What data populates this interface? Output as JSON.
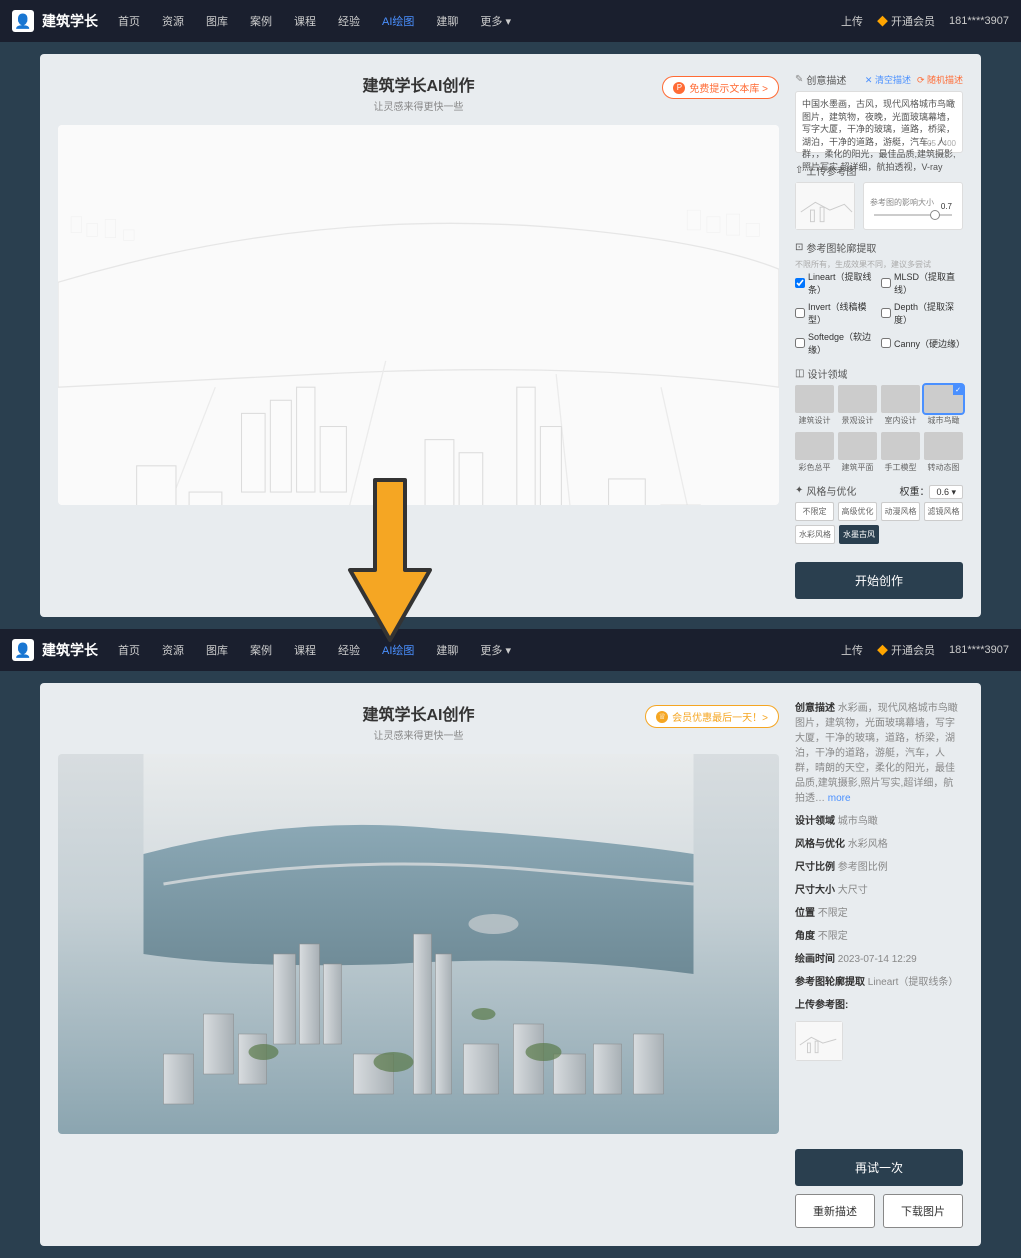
{
  "nav": {
    "brand": "建筑学长",
    "items": [
      "首页",
      "资源",
      "图库",
      "案例",
      "课程",
      "经验",
      "AI绘图",
      "建聊",
      "更多 ▾"
    ],
    "active_index": 6,
    "upload": "上传",
    "vip": "开通会员",
    "user": "181****3907"
  },
  "top": {
    "title": "建筑学长AI创作",
    "subtitle": "让灵感来得更快一些",
    "pill_label": "免费提示文本库 >",
    "prompt_section": "创意描述",
    "clear_link": "✕ 清空描述",
    "random_link": "⟳ 随机描述",
    "prompt_text": "中国水墨画，古风，现代风格城市鸟瞰图片，建筑物，夜晚，光面玻璃幕墙，写字大厦，干净的玻璃，道路，桥梁，湖泊，干净的道路，游艇，汽车，人群，，柔化的阳光，最佳品质,建筑摄影,照片写实,超详细，航拍透视，V-ray",
    "char_count": "105 / 400",
    "ref_section": "上传参考图",
    "slider_label": "参考图的影响大小",
    "slider_value": "0.7",
    "outline_section": "参考图轮廓提取",
    "outline_hint": "不限所有，生成效果不同，建议多尝试",
    "checks": [
      {
        "label": "Lineart（提取线条）",
        "checked": true
      },
      {
        "label": "MLSD（提取直线）",
        "checked": false
      },
      {
        "label": "Invert（线稿模型）",
        "checked": false
      },
      {
        "label": "Depth（提取深度）",
        "checked": false
      },
      {
        "label": "Softedge（软边缘）",
        "checked": false
      },
      {
        "label": "Canny（硬边缘）",
        "checked": false
      }
    ],
    "design_section": "设计领域",
    "styles1": [
      "建筑设计",
      "景观设计",
      "室内设计",
      "城市鸟瞰"
    ],
    "styles2": [
      "彩色总平",
      "建筑平面",
      "手工模型",
      "转动态图"
    ],
    "selected_style_index": 3,
    "style_opt_section": "风格与优化",
    "weight_label": "权重：",
    "weight_value": "0.6",
    "tags1": [
      "不限定",
      "高级优化",
      "动漫风格",
      "滤镜风格"
    ],
    "tags2": [
      "水彩风格",
      "水墨古风"
    ],
    "selected_tag": "水墨古风",
    "start_btn": "开始创作"
  },
  "bottom": {
    "title": "建筑学长AI创作",
    "subtitle": "让灵感来得更快一些",
    "pill_label": "会员优惠最后一天！>",
    "desc_label": "创意描述",
    "desc_text": "水彩画，现代风格城市鸟瞰图片，建筑物，光面玻璃幕墙，写字大厦，干净的玻璃，道路，桥梁，湖泊，干净的道路，游艇，汽车，人群，晴朗的天空，柔化的阳光，最佳品质,建筑摄影,照片写实,超详细，航拍透…",
    "more": "more",
    "fields": [
      {
        "label": "设计领域",
        "value": "城市鸟瞰"
      },
      {
        "label": "风格与优化",
        "value": "水彩风格"
      },
      {
        "label": "尺寸比例",
        "value": "参考图比例"
      },
      {
        "label": "尺寸大小",
        "value": "大尺寸"
      },
      {
        "label": "位置",
        "value": "不限定"
      },
      {
        "label": "角度",
        "value": "不限定"
      },
      {
        "label": "绘画时间",
        "value": "2023-07-14 12:29"
      },
      {
        "label": "参考图轮廓提取",
        "value": "Lineart（提取线条）"
      }
    ],
    "ref_label": "上传参考图:",
    "retry_btn": "再试一次",
    "redesign_btn": "重新描述",
    "download_btn": "下载图片"
  }
}
